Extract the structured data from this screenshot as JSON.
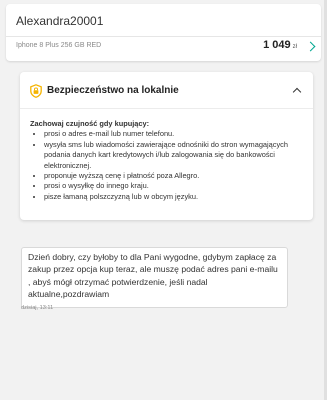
{
  "conversation": {
    "username": "Alexandra20001",
    "product_name": "Iphone 8 Plus 256 GB RED",
    "price": "1 049",
    "currency": "zł"
  },
  "safety": {
    "title": "Bezpieczeństwo na lokalnie",
    "heading": "Zachowaj czujność gdy kupujący:",
    "items": [
      "prosi o adres e-mail lub numer telefonu.",
      "wysyła sms lub wiadomości zawierające odnośniki do stron wymagających podania danych kart kredytowych i/lub zalogowania się do bankowości elektronicznej.",
      "proponuje wyższą cenę i płatność poza Allegro.",
      "prosi o wysyłkę do innego kraju.",
      "pisze łamaną polszczyzną lub w obcym języku."
    ],
    "accent_color": "#f5b400"
  },
  "message": {
    "text": "Dzień dobry, czy byłoby to dla Pani wygodne, gdybym zapłacę za zakup przez opcja kup teraz, ale muszę podać adres pani e-mailu , abyś mógł otrzymać potwierdzenie, jeśli nadal aktualne,pozdrawiam",
    "time": "dzisiaj, 13:11"
  },
  "icons": {
    "shield": "shield-icon",
    "chevron_right": "chevron-right-icon",
    "chevron_up": "chevron-up-icon"
  },
  "colors": {
    "accent_green": "#00a790",
    "background": "#f2f2f2"
  }
}
